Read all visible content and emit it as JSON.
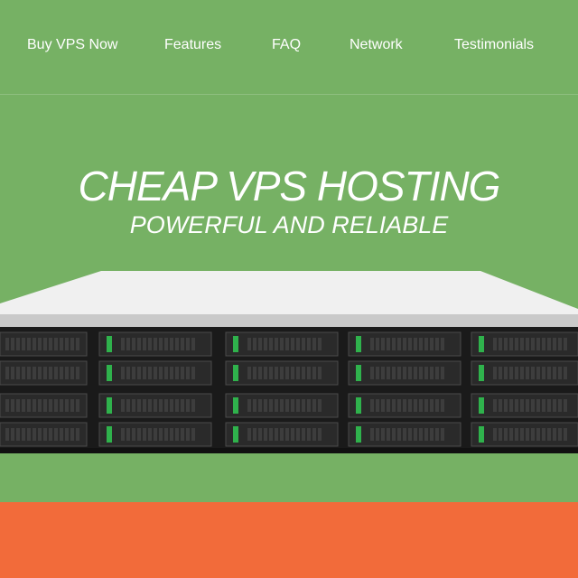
{
  "nav": {
    "items": [
      {
        "label": "Buy VPS Now"
      },
      {
        "label": "Features"
      },
      {
        "label": "FAQ"
      },
      {
        "label": "Network"
      },
      {
        "label": "Testimonials"
      }
    ]
  },
  "hero": {
    "title": "CHEAP VPS HOSTING",
    "subtitle": "POWERFUL AND RELIABLE",
    "image": "rack-server-illustration"
  },
  "colors": {
    "background": "#76b164",
    "accent_band": "#f26b3a",
    "drive_led": "#2fb24c",
    "server_dark": "#1f1f1f"
  }
}
